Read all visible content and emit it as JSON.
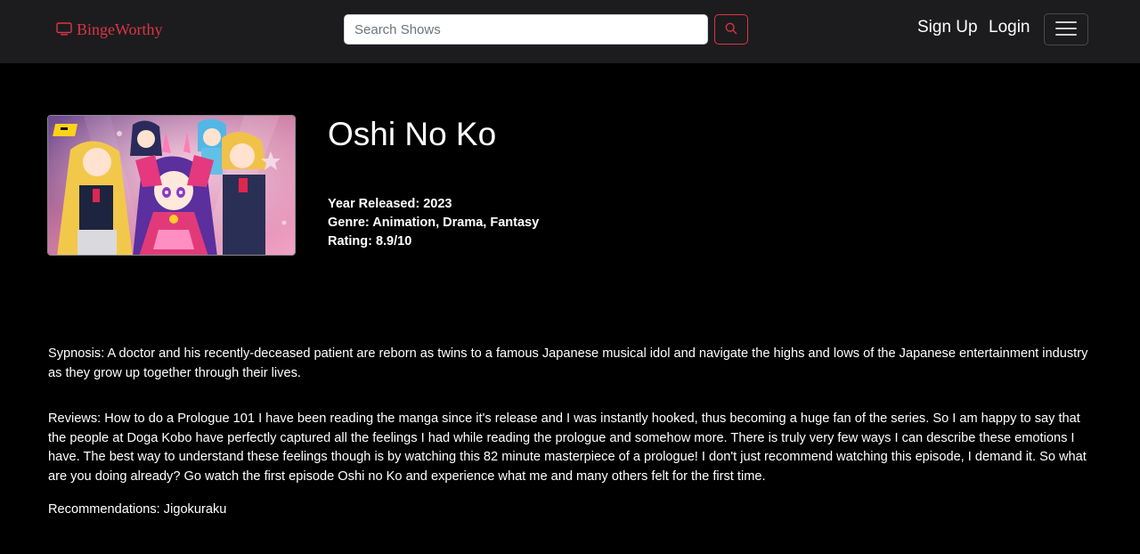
{
  "navbar": {
    "brand": "BingeWorthy",
    "search_placeholder": "Search Shows",
    "links": [
      "Sign Up",
      "Login"
    ]
  },
  "show": {
    "title": "Oshi No Ko",
    "year": "Year Released: 2023",
    "genre": "Genre: Animation, Drama, Fantasy",
    "rating": "Rating: 8.9/10",
    "synopsis": "Sypnosis: A doctor and his recently-deceased patient are reborn as twins to a famous Japanese musical idol and navigate the highs and lows of the Japanese entertainment industry as they grow up together through their lives.",
    "reviews": "Reviews: How to do a Prologue 101 I have been reading the manga since it's release and I was instantly hooked, thus becoming a huge fan of the series. So I am happy to say that the people at Doga Kobo have perfectly captured all the feelings I had while reading the prologue and somehow more. There is truly very few ways I can describe these emotions I have. The best way to understand these feelings though is by watching this 82 minute masterpiece of a prologue! I don't just recommend watching this episode, I demand it. So what are you doing already? Go watch the first episode Oshi no Ko and experience what me and many others felt for the first time.",
    "recommendations": "Recommendations: Jigokuraku"
  },
  "icons": {
    "brand": "tv-icon",
    "search": "search-icon",
    "menu": "hamburger-menu-icon"
  },
  "colors": {
    "navbar_bg": "#1c1c1e",
    "page_bg": "#000000",
    "accent": "#dc3545",
    "text": "#ffffff"
  }
}
